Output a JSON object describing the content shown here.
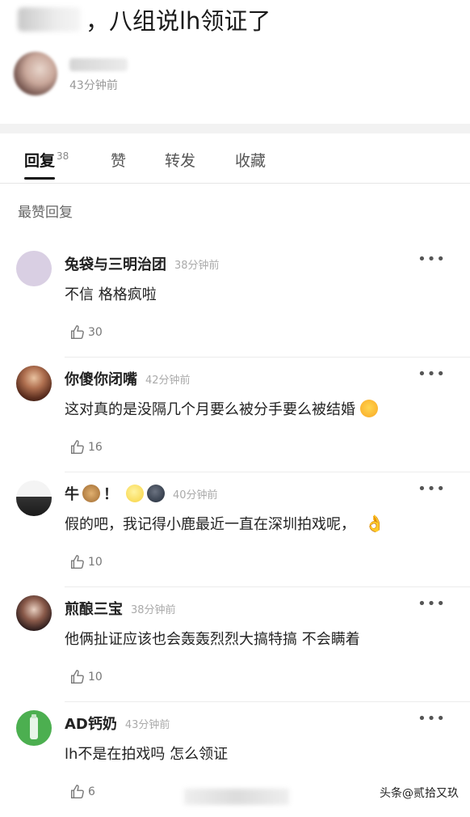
{
  "post": {
    "title": "，八组说lh领证了",
    "time": "43分钟前"
  },
  "tabs": [
    {
      "label": "回复",
      "count": "38"
    },
    {
      "label": "赞"
    },
    {
      "label": "转发"
    },
    {
      "label": "收藏"
    }
  ],
  "section_title": "最赞回复",
  "comments": [
    {
      "name": "兔袋与三明治团",
      "time": "38分钟前",
      "text": "不信 格格疯啦",
      "likes": "30",
      "avatar_color": "#d9cfe3"
    },
    {
      "name": "你傻你闭嘴",
      "time": "42分钟前",
      "text": "这对真的是没隔几个月要么被分手要么被结婚",
      "likes": "16",
      "avatar_color": "#6b3b2b"
    },
    {
      "name": "牛",
      "name_suffix": "！",
      "time": "40分钟前",
      "text": "假的吧，我记得小鹿最近一直在深圳拍戏呢，",
      "likes": "10",
      "avatar_color": "#2b2b2b"
    },
    {
      "name": "煎酿三宝",
      "time": "38分钟前",
      "text": "他俩扯证应该也会轰轰烈烈大搞特搞 不会瞒着",
      "likes": "10",
      "avatar_color": "#3a2a2a"
    },
    {
      "name": "AD钙奶",
      "time": "43分钟前",
      "text": "lh不是在拍戏吗 怎么领证",
      "likes": "6",
      "avatar_color": "#4caf50"
    }
  ],
  "more_label": "•••",
  "watermark": "头条@贰拾又玖"
}
